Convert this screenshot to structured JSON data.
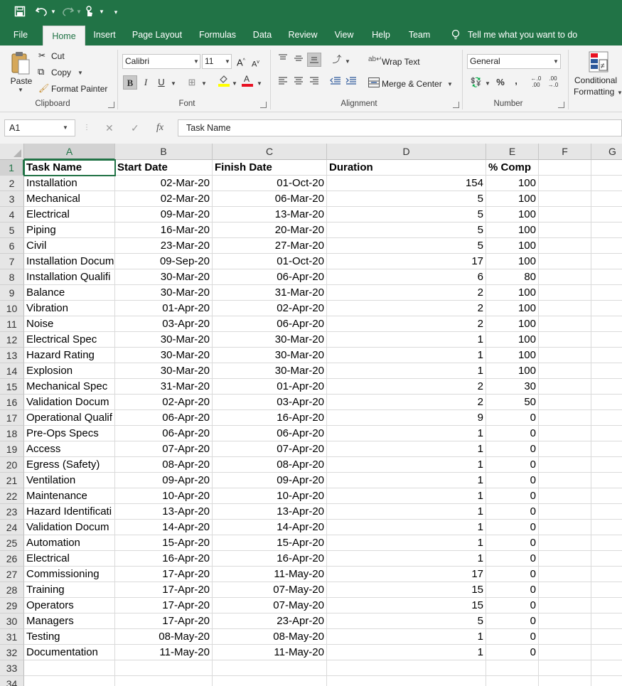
{
  "qat": {
    "save_icon": "save-icon",
    "undo_icon": "undo-icon",
    "redo_icon": "redo-icon",
    "touch_icon": "touch-mode-icon",
    "customize_icon": "customize-qat-icon"
  },
  "tabs": [
    "File",
    "Home",
    "Insert",
    "Page Layout",
    "Formulas",
    "Data",
    "Review",
    "View",
    "Help",
    "Team"
  ],
  "tell_me": "Tell me what you want to do",
  "ribbon": {
    "clipboard": {
      "paste": "Paste",
      "cut": "Cut",
      "copy": "Copy",
      "format_painter": "Format Painter",
      "label": "Clipboard"
    },
    "font": {
      "name": "Calibri",
      "size": "11",
      "bold": "B",
      "italic": "I",
      "underline": "U",
      "label": "Font"
    },
    "alignment": {
      "wrap_text": "Wrap Text",
      "merge_center": "Merge & Center",
      "label": "Alignment"
    },
    "number": {
      "format": "General",
      "percent": "%",
      "comma": ",",
      "inc_dec": "←.0 .00",
      "dec_dec": ".00 →.0",
      "label": "Number"
    },
    "styles": {
      "conditional": "Conditional",
      "formatting": "Formatting"
    }
  },
  "formula_bar": {
    "name_box": "A1",
    "fx": "fx",
    "content": "Task Name"
  },
  "columns": [
    "A",
    "B",
    "C",
    "D",
    "E",
    "F",
    "G"
  ],
  "header_row": [
    "Task Name",
    "Start Date",
    "Finish Date",
    "Duration",
    "% Comp"
  ],
  "rows": [
    [
      "Installation",
      "02-Mar-20",
      "01-Oct-20",
      "154",
      "100"
    ],
    [
      "Mechanical",
      "02-Mar-20",
      "06-Mar-20",
      "5",
      "100"
    ],
    [
      "Electrical",
      "09-Mar-20",
      "13-Mar-20",
      "5",
      "100"
    ],
    [
      "Piping",
      "16-Mar-20",
      "20-Mar-20",
      "5",
      "100"
    ],
    [
      "Civil",
      "23-Mar-20",
      "27-Mar-20",
      "5",
      "100"
    ],
    [
      "Installation Docum",
      "09-Sep-20",
      "01-Oct-20",
      "17",
      "100"
    ],
    [
      "Installation Qualifi",
      "30-Mar-20",
      "06-Apr-20",
      "6",
      "80"
    ],
    [
      "Balance",
      "30-Mar-20",
      "31-Mar-20",
      "2",
      "100"
    ],
    [
      "Vibration",
      "01-Apr-20",
      "02-Apr-20",
      "2",
      "100"
    ],
    [
      "Noise",
      "03-Apr-20",
      "06-Apr-20",
      "2",
      "100"
    ],
    [
      "Electrical Spec",
      "30-Mar-20",
      "30-Mar-20",
      "1",
      "100"
    ],
    [
      "Hazard Rating",
      "30-Mar-20",
      "30-Mar-20",
      "1",
      "100"
    ],
    [
      "Explosion",
      "30-Mar-20",
      "30-Mar-20",
      "1",
      "100"
    ],
    [
      "Mechanical Spec",
      "31-Mar-20",
      "01-Apr-20",
      "2",
      "30"
    ],
    [
      "Validation Docum",
      "02-Apr-20",
      "03-Apr-20",
      "2",
      "50"
    ],
    [
      "Operational Qualif",
      "06-Apr-20",
      "16-Apr-20",
      "9",
      "0"
    ],
    [
      "Pre-Ops Specs",
      "06-Apr-20",
      "06-Apr-20",
      "1",
      "0"
    ],
    [
      "Access",
      "07-Apr-20",
      "07-Apr-20",
      "1",
      "0"
    ],
    [
      "Egress (Safety)",
      "08-Apr-20",
      "08-Apr-20",
      "1",
      "0"
    ],
    [
      "Ventilation",
      "09-Apr-20",
      "09-Apr-20",
      "1",
      "0"
    ],
    [
      "Maintenance",
      "10-Apr-20",
      "10-Apr-20",
      "1",
      "0"
    ],
    [
      "Hazard Identificati",
      "13-Apr-20",
      "13-Apr-20",
      "1",
      "0"
    ],
    [
      "Validation Docum",
      "14-Apr-20",
      "14-Apr-20",
      "1",
      "0"
    ],
    [
      "Automation",
      "15-Apr-20",
      "15-Apr-20",
      "1",
      "0"
    ],
    [
      "Electrical",
      "16-Apr-20",
      "16-Apr-20",
      "1",
      "0"
    ],
    [
      "Commissioning",
      "17-Apr-20",
      "11-May-20",
      "17",
      "0"
    ],
    [
      "Training",
      "17-Apr-20",
      "07-May-20",
      "15",
      "0"
    ],
    [
      "Operators",
      "17-Apr-20",
      "07-May-20",
      "15",
      "0"
    ],
    [
      "Managers",
      "17-Apr-20",
      "23-Apr-20",
      "5",
      "0"
    ],
    [
      "Testing",
      "08-May-20",
      "08-May-20",
      "1",
      "0"
    ],
    [
      "Documentation",
      "11-May-20",
      "11-May-20",
      "1",
      "0"
    ]
  ],
  "row_numbers": [
    "1",
    "2",
    "3",
    "4",
    "5",
    "6",
    "7",
    "8",
    "9",
    "10",
    "11",
    "12",
    "13",
    "14",
    "15",
    "16",
    "17",
    "18",
    "19",
    "20",
    "21",
    "22",
    "23",
    "24",
    "25",
    "26",
    "27",
    "28",
    "29",
    "30",
    "31",
    "32",
    "33",
    "34"
  ],
  "colors": {
    "accent": "#217346",
    "font_color_bar": "#e81123",
    "highlight_bar": "#ffff00"
  }
}
